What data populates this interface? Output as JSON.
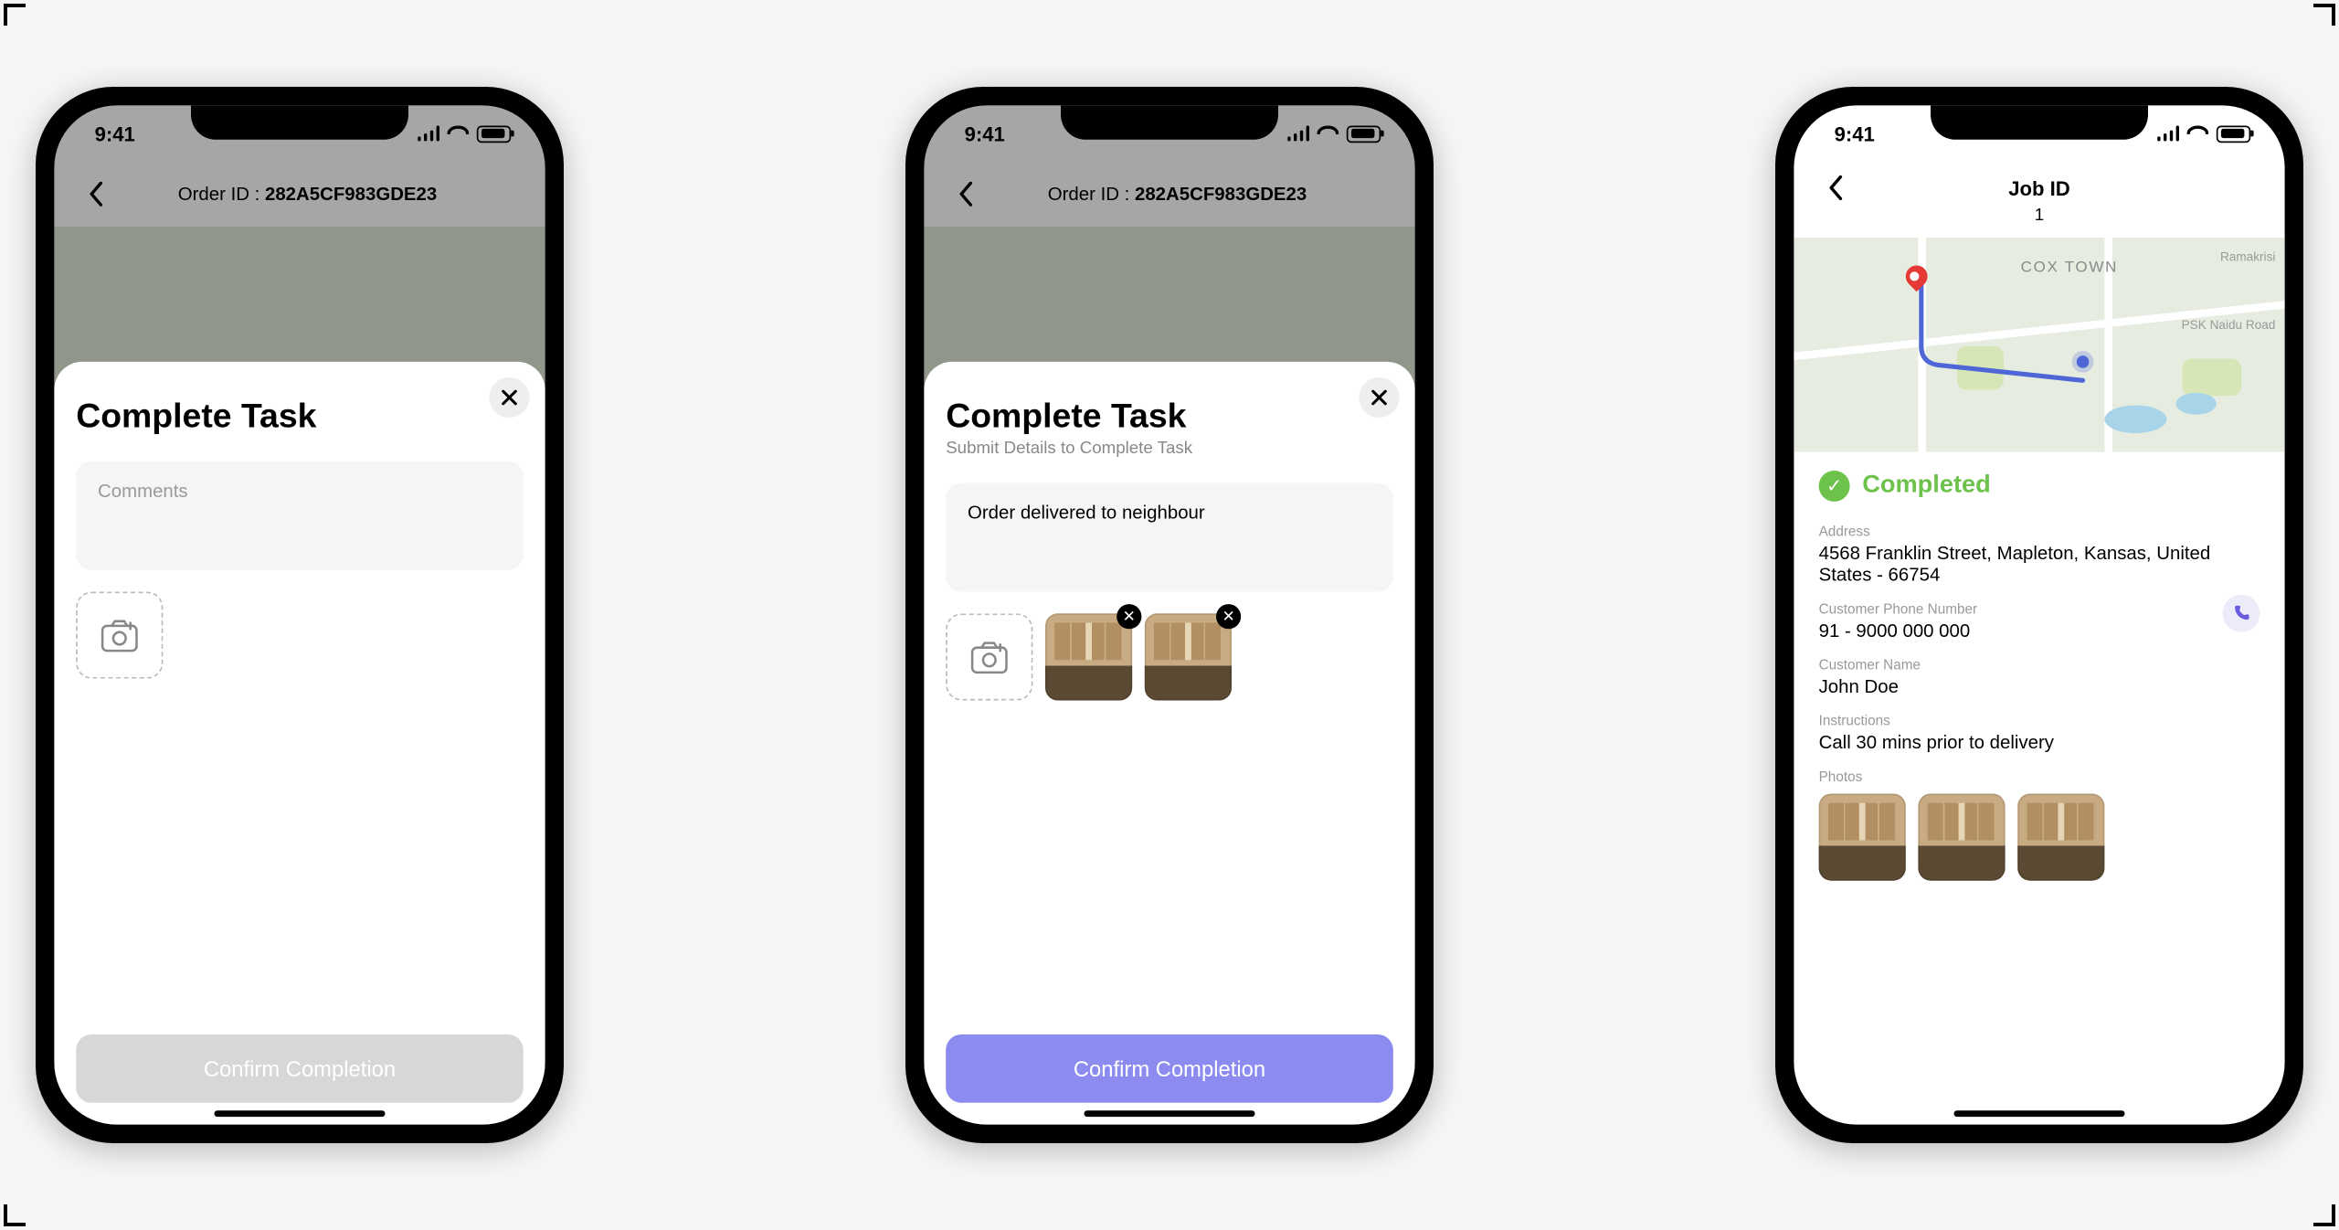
{
  "statusbar": {
    "time": "9:41"
  },
  "orderHeader": {
    "prefix": "Order ID : ",
    "id": "282A5CF983GDE23"
  },
  "sheet": {
    "title": "Complete Task",
    "subtitle": "Submit Details to Complete Task",
    "commentsPlaceholder": "Comments",
    "commentsValue": "Order delivered to neighbour",
    "confirm": "Confirm Completion"
  },
  "jobHeader": {
    "title": "Job ID",
    "id": "1"
  },
  "map": {
    "area": "COX TOWN",
    "road1": "Ramakrisi",
    "road2": "PSK Naidu Road"
  },
  "status": {
    "text": "Completed"
  },
  "details": {
    "addressLabel": "Address",
    "address": "4568 Franklin Street, Mapleton, Kansas, United States - 66754",
    "phoneLabel": "Customer Phone Number",
    "phone": "91 - 9000 000 000",
    "nameLabel": "Customer Name",
    "name": "John Doe",
    "instrLabel": "Instructions",
    "instr": "Call 30 mins prior to delivery",
    "photosLabel": "Photos"
  }
}
